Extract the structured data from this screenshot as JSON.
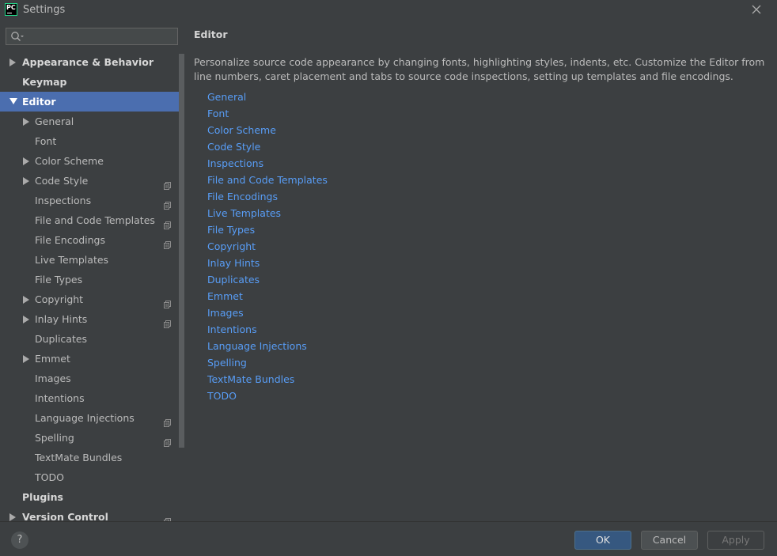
{
  "window": {
    "title": "Settings",
    "logo_text": "PC"
  },
  "search": {
    "value": "",
    "placeholder": ""
  },
  "tree": [
    {
      "label": "Appearance & Behavior",
      "level": 0,
      "expandable": true,
      "expanded": false,
      "project_icon": false
    },
    {
      "label": "Keymap",
      "level": 0,
      "expandable": false,
      "expanded": false,
      "project_icon": false
    },
    {
      "label": "Editor",
      "level": 0,
      "expandable": true,
      "expanded": true,
      "selected": true,
      "project_icon": false
    },
    {
      "label": "General",
      "level": 1,
      "expandable": true,
      "expanded": false,
      "project_icon": false
    },
    {
      "label": "Font",
      "level": 1,
      "expandable": false,
      "expanded": false,
      "project_icon": false
    },
    {
      "label": "Color Scheme",
      "level": 1,
      "expandable": true,
      "expanded": false,
      "project_icon": false
    },
    {
      "label": "Code Style",
      "level": 1,
      "expandable": true,
      "expanded": false,
      "project_icon": true
    },
    {
      "label": "Inspections",
      "level": 1,
      "expandable": false,
      "expanded": false,
      "project_icon": true
    },
    {
      "label": "File and Code Templates",
      "level": 1,
      "expandable": false,
      "expanded": false,
      "project_icon": true
    },
    {
      "label": "File Encodings",
      "level": 1,
      "expandable": false,
      "expanded": false,
      "project_icon": true
    },
    {
      "label": "Live Templates",
      "level": 1,
      "expandable": false,
      "expanded": false,
      "project_icon": false
    },
    {
      "label": "File Types",
      "level": 1,
      "expandable": false,
      "expanded": false,
      "project_icon": false
    },
    {
      "label": "Copyright",
      "level": 1,
      "expandable": true,
      "expanded": false,
      "project_icon": true
    },
    {
      "label": "Inlay Hints",
      "level": 1,
      "expandable": true,
      "expanded": false,
      "project_icon": true
    },
    {
      "label": "Duplicates",
      "level": 1,
      "expandable": false,
      "expanded": false,
      "project_icon": false
    },
    {
      "label": "Emmet",
      "level": 1,
      "expandable": true,
      "expanded": false,
      "project_icon": false
    },
    {
      "label": "Images",
      "level": 1,
      "expandable": false,
      "expanded": false,
      "project_icon": false
    },
    {
      "label": "Intentions",
      "level": 1,
      "expandable": false,
      "expanded": false,
      "project_icon": false
    },
    {
      "label": "Language Injections",
      "level": 1,
      "expandable": false,
      "expanded": false,
      "project_icon": true
    },
    {
      "label": "Spelling",
      "level": 1,
      "expandable": false,
      "expanded": false,
      "project_icon": true
    },
    {
      "label": "TextMate Bundles",
      "level": 1,
      "expandable": false,
      "expanded": false,
      "project_icon": false
    },
    {
      "label": "TODO",
      "level": 1,
      "expandable": false,
      "expanded": false,
      "project_icon": false
    },
    {
      "label": "Plugins",
      "level": 0,
      "expandable": false,
      "expanded": false,
      "project_icon": false
    },
    {
      "label": "Version Control",
      "level": 0,
      "expandable": true,
      "expanded": false,
      "project_icon": true
    }
  ],
  "main": {
    "title": "Editor",
    "description": "Personalize source code appearance by changing fonts, highlighting styles, indents, etc. Customize the Editor from line numbers, caret placement and tabs to source code inspections, setting up templates and file encodings.",
    "links": [
      "General",
      "Font",
      "Color Scheme",
      "Code Style",
      "Inspections",
      "File and Code Templates",
      "File Encodings",
      "Live Templates",
      "File Types",
      "Copyright",
      "Inlay Hints",
      "Duplicates",
      "Emmet",
      "Images",
      "Intentions",
      "Language Injections",
      "Spelling",
      "TextMate Bundles",
      "TODO"
    ]
  },
  "footer": {
    "help_label": "?",
    "ok_label": "OK",
    "cancel_label": "Cancel",
    "apply_label": "Apply"
  },
  "colors": {
    "background": "#3c3f41",
    "selection": "#4b6eaf",
    "link": "#589df6",
    "primary_button": "#365880"
  }
}
